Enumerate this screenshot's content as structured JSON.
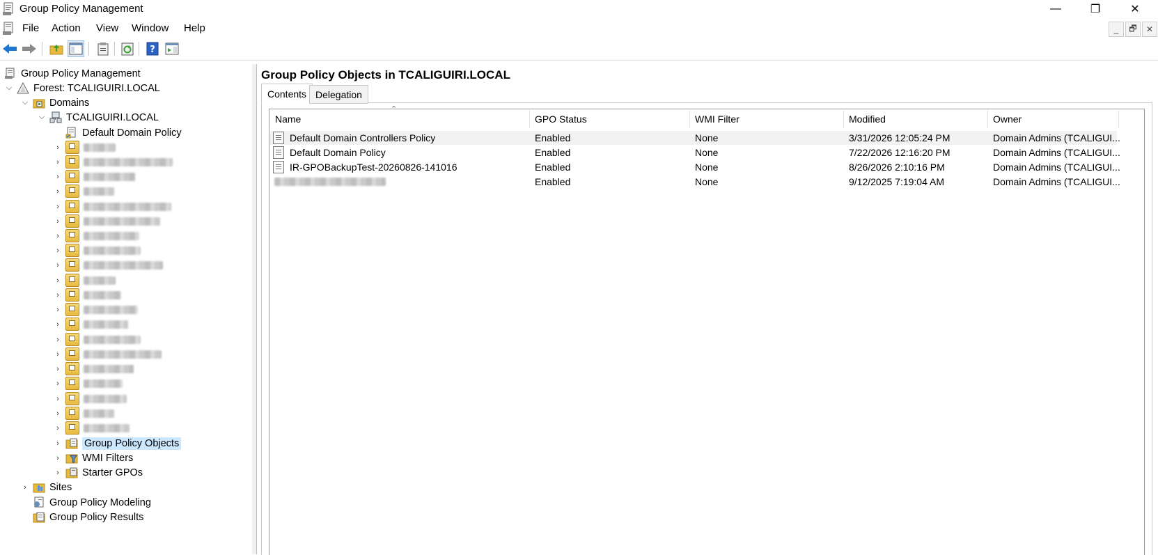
{
  "window": {
    "title": "Group Policy Management",
    "minimize": "—",
    "restore": "❐",
    "close": "✕"
  },
  "menu": {
    "items": [
      "File",
      "Action",
      "View",
      "Window",
      "Help"
    ],
    "mdi": [
      "_",
      "🗗",
      "✕"
    ]
  },
  "tree": {
    "root": "Group Policy Management",
    "forest": "Forest: TCALIGUIRI.LOCAL",
    "domains": "Domains",
    "domain": "TCALIGUIRI.LOCAL",
    "default_policy": "Default Domain Policy",
    "gpo_objects": "Group Policy Objects",
    "wmi_filters": "WMI Filters",
    "starter_gpos": "Starter GPOs",
    "sites": "Sites",
    "modeling": "Group Policy Modeling",
    "results": "Group Policy Results"
  },
  "main": {
    "heading": "Group Policy Objects in TCALIGUIRI.LOCAL",
    "tabs": [
      "Contents",
      "Delegation"
    ],
    "columns": [
      "Name",
      "GPO Status",
      "WMI Filter",
      "Modified",
      "Owner"
    ],
    "rows": [
      {
        "name": "Default Domain Controllers Policy",
        "status": "Enabled",
        "wmi": "None",
        "modified": "3/31/2026 12:05:24 PM",
        "owner": "Domain Admins (TCALIGUI..."
      },
      {
        "name": "Default Domain Policy",
        "status": "Enabled",
        "wmi": "None",
        "modified": "7/22/2026 12:16:20 PM",
        "owner": "Domain Admins (TCALIGUI..."
      },
      {
        "name": "IR-GPOBackupTest-20260826-141016",
        "status": "Enabled",
        "wmi": "None",
        "modified": "8/26/2026 2:10:16 PM",
        "owner": "Domain Admins (TCALIGUI..."
      },
      {
        "name": "",
        "status": "Enabled",
        "wmi": "None",
        "modified": "9/12/2025 7:19:04 AM",
        "owner": "Domain Admins (TCALIGUI..."
      }
    ]
  },
  "colors": {
    "selection": "#cce8ff",
    "accent_blue": "#1e78d2",
    "accent_green": "#3aa02f",
    "folder": "#e8b93e"
  }
}
